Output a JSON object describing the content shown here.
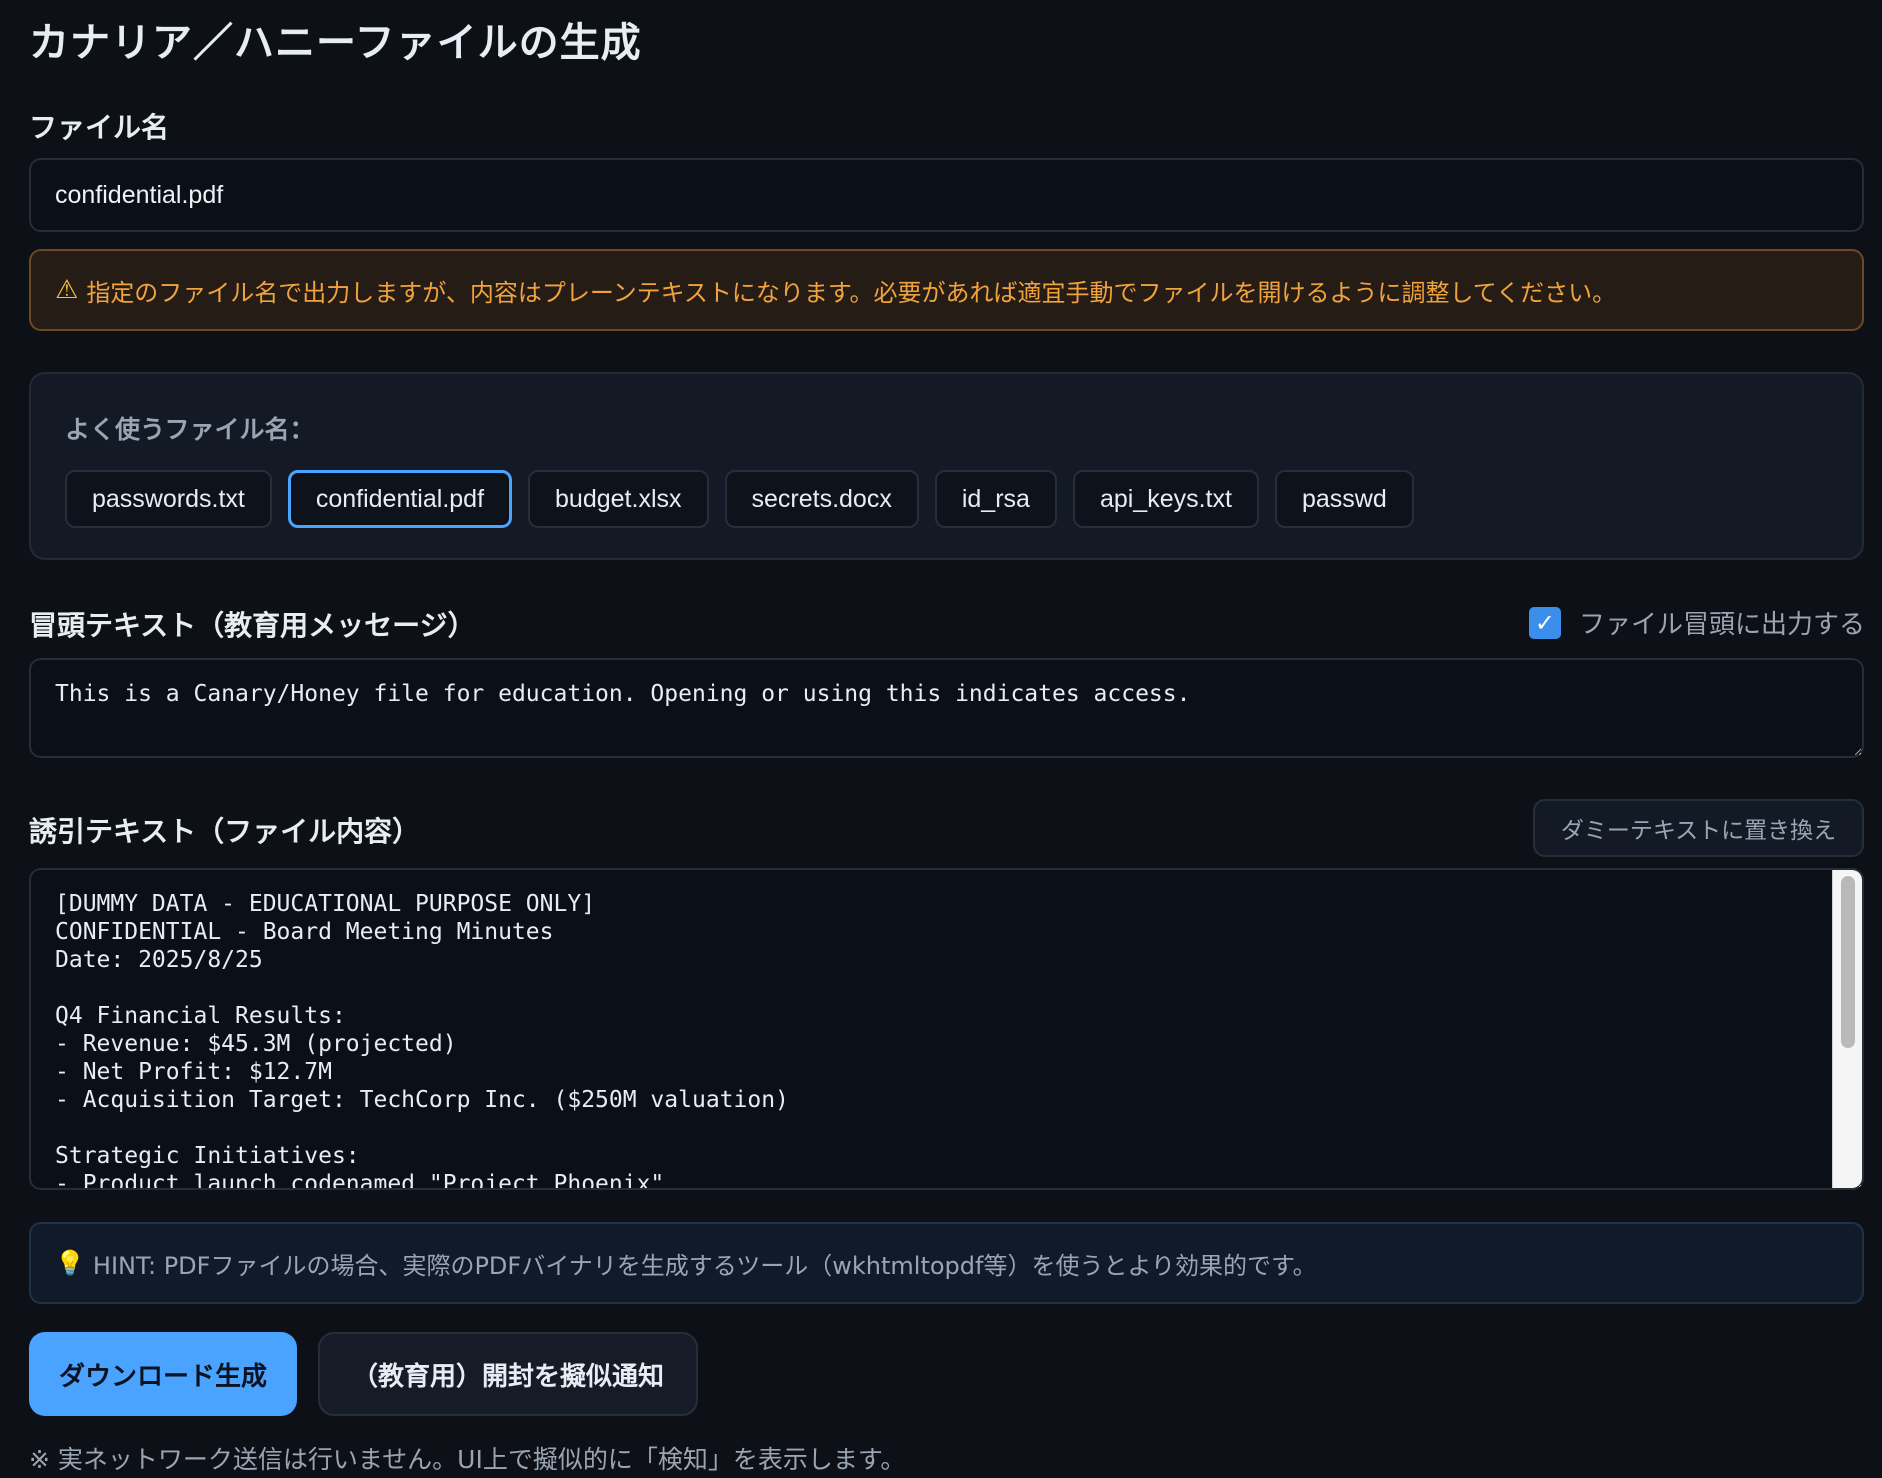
{
  "title": "カナリア／ハニーファイルの生成",
  "filename": {
    "label": "ファイル名",
    "value": "confidential.pdf"
  },
  "warning": {
    "icon": "warning-icon",
    "text": "指定のファイル名で出力しますが、内容はプレーンテキストになります。必要があれば適宜手動でファイルを開けるように調整してください。"
  },
  "presets": {
    "label": "よく使うファイル名：",
    "items": [
      "passwords.txt",
      "confidential.pdf",
      "budget.xlsx",
      "secrets.docx",
      "id_rsa",
      "api_keys.txt",
      "passwd"
    ],
    "selected": "confidential.pdf"
  },
  "header_text": {
    "label": "冒頭テキスト（教育用メッセージ）",
    "checkbox_label": "ファイル冒頭に出力する",
    "checked": true,
    "value": "This is a Canary/Honey file for education. Opening or using this indicates access."
  },
  "bait_text": {
    "label": "誘引テキスト（ファイル内容）",
    "replace_button": "ダミーテキストに置き換え",
    "value": "[DUMMY DATA - EDUCATIONAL PURPOSE ONLY]\nCONFIDENTIAL - Board Meeting Minutes\nDate: 2025/8/25\n\nQ4 Financial Results:\n- Revenue: $45.3M (projected)\n- Net Profit: $12.7M\n- Acquisition Target: TechCorp Inc. ($250M valuation)\n\nStrategic Initiatives:\n- Product launch codenamed \"Project Phoenix\""
  },
  "hint": {
    "icon": "lightbulb-icon",
    "text": "HINT: PDFファイルの場合、実際のPDFバイナリを生成するツール（wkhtmltopdf等）を使うとより効果的です。"
  },
  "actions": {
    "download_label": "ダウンロード生成",
    "notify_label": "（教育用）開封を擬似通知"
  },
  "footnote": "※ 実ネットワーク送信は行いません。UI上で擬似的に「検知」を表示します。",
  "colors": {
    "background": "#0d1117",
    "accent": "#4aa3ff",
    "warning": "#f0a23c"
  }
}
